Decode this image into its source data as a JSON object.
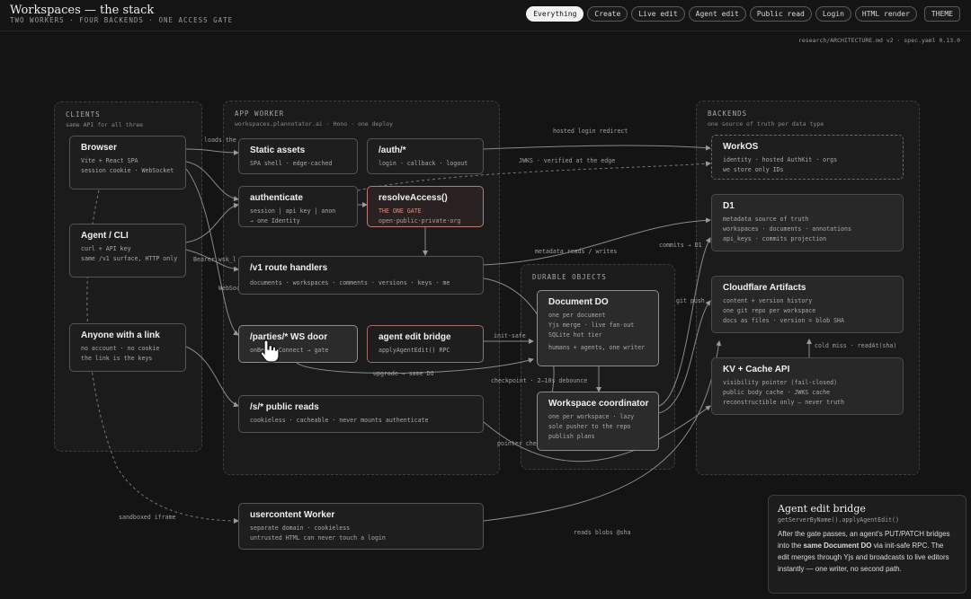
{
  "header": {
    "title": "Workspaces — the stack",
    "subtitle": "TWO WORKERS · FOUR BACKENDS · ONE ACCESS GATE",
    "filters": [
      "Everything",
      "Create",
      "Live edit",
      "Agent edit",
      "Public read",
      "Login",
      "HTML render"
    ],
    "active_filter": "Everything",
    "theme_label": "THEME",
    "meta": "research/ARCHITECTURE.md v2 · spec.yaml 0.13.0"
  },
  "groups": {
    "clients": {
      "title": "CLIENTS",
      "subtitle": "same API for all three"
    },
    "app_worker": {
      "title": "APP WORKER",
      "subtitle": "workspaces.plannotator.ai · Hono · one deploy"
    },
    "backends": {
      "title": "BACKENDS",
      "subtitle": "one source of truth per data type"
    },
    "durable_objects": {
      "title": "DURABLE OBJECTS"
    }
  },
  "nodes": {
    "browser": {
      "title": "Browser",
      "lines": [
        "Vite + React SPA",
        "session cookie · WebSocket"
      ]
    },
    "agent_cli": {
      "title": "Agent / CLI",
      "lines": [
        "curl + API key",
        "same /v1 surface, HTTP only"
      ]
    },
    "anyone_link": {
      "title": "Anyone with a link",
      "lines": [
        "no account · no cookie",
        "the link is the keys"
      ]
    },
    "static_assets": {
      "title": "Static assets",
      "lines": [
        "SPA shell · edge-cached"
      ]
    },
    "auth": {
      "title": "/auth/*",
      "lines": [
        "login · callback · logout"
      ]
    },
    "authenticate": {
      "title": "authenticate",
      "lines": [
        "session | api key | anon",
        "→ one Identity"
      ]
    },
    "resolve_access": {
      "title": "resolveAccess()",
      "lines": [
        "THE ONE GATE",
        "open·public·private·org"
      ]
    },
    "v1_routes": {
      "title": "/v1 route handlers",
      "lines": [
        "documents · workspaces · comments · versions · keys · me"
      ]
    },
    "ws_door": {
      "title": "/parties/* WS door",
      "lines": [
        "onBeforeConnect → gate"
      ]
    },
    "agent_bridge": {
      "title": "agent edit bridge",
      "lines": [
        "applyAgentEdit() RPC"
      ]
    },
    "public_reads": {
      "title": "/s/* public reads",
      "lines": [
        "cookieless · cacheable · never mounts authenticate"
      ]
    },
    "usercontent": {
      "title": "usercontent Worker",
      "lines": [
        "separate domain · cookieless",
        "untrusted HTML can never touch a login"
      ]
    },
    "document_do": {
      "title": "Document DO",
      "lines": [
        "one per document",
        "Yjs merge · live fan-out",
        "SQLite hot tier",
        "humans + agents, one writer"
      ]
    },
    "workspace_coord": {
      "title": "Workspace coordinator",
      "lines": [
        "one per workspace · lazy",
        "sole pusher to the repo",
        "publish plans"
      ]
    },
    "workos": {
      "title": "WorkOS",
      "lines": [
        "identity · hosted AuthKit · orgs",
        "we store only IDs"
      ]
    },
    "d1": {
      "title": "D1",
      "lines": [
        "metadata source of truth",
        "workspaces · documents · annotations",
        "api_keys · commits projection"
      ]
    },
    "artifacts": {
      "title": "Cloudflare Artifacts",
      "lines": [
        "content + version history",
        "one git repo per workspace",
        "docs as files · version = blob SHA"
      ]
    },
    "kv_cache": {
      "title": "KV + Cache API",
      "lines": [
        "visibility pointer (fail-closed)",
        "public body cache · JWKS cache",
        "reconstructible only — never truth"
      ]
    }
  },
  "edges": {
    "loads_the": "loads the",
    "hosted_login": "hosted login redirect",
    "jwks": "JWKS · verified at the edge",
    "bearer": "Bearer wsk_l",
    "websoc": "WebSoc",
    "metadata": "metadata reads / writes",
    "commits": "commits → D1",
    "git_push": "git push",
    "init_safe": "init-safe",
    "upgrade": "upgrade → same DO",
    "checkpoint": "checkpoint · 2–10s debounce",
    "pointer_check": "pointer check · cached body",
    "cold_miss": "cold miss · readAt(sha)",
    "sandboxed": "sandboxed iframe",
    "reads_blobs": "reads blobs @sha"
  },
  "info": {
    "title": "Agent edit bridge",
    "subtitle": "getServerByName().applyAgentEdit()",
    "body_a": "After the gate passes, an agent's PUT/PATCH bridges into the ",
    "body_bold": "same Document DO",
    "body_b": " via init-safe RPC. The edit merges through Yjs and broadcasts to live editors instantly — one writer, no second path."
  },
  "colors": {
    "background": "#141414",
    "accent_gate": "#e58b7e",
    "node_border": "#555555",
    "wire": "#8a8a8a"
  }
}
